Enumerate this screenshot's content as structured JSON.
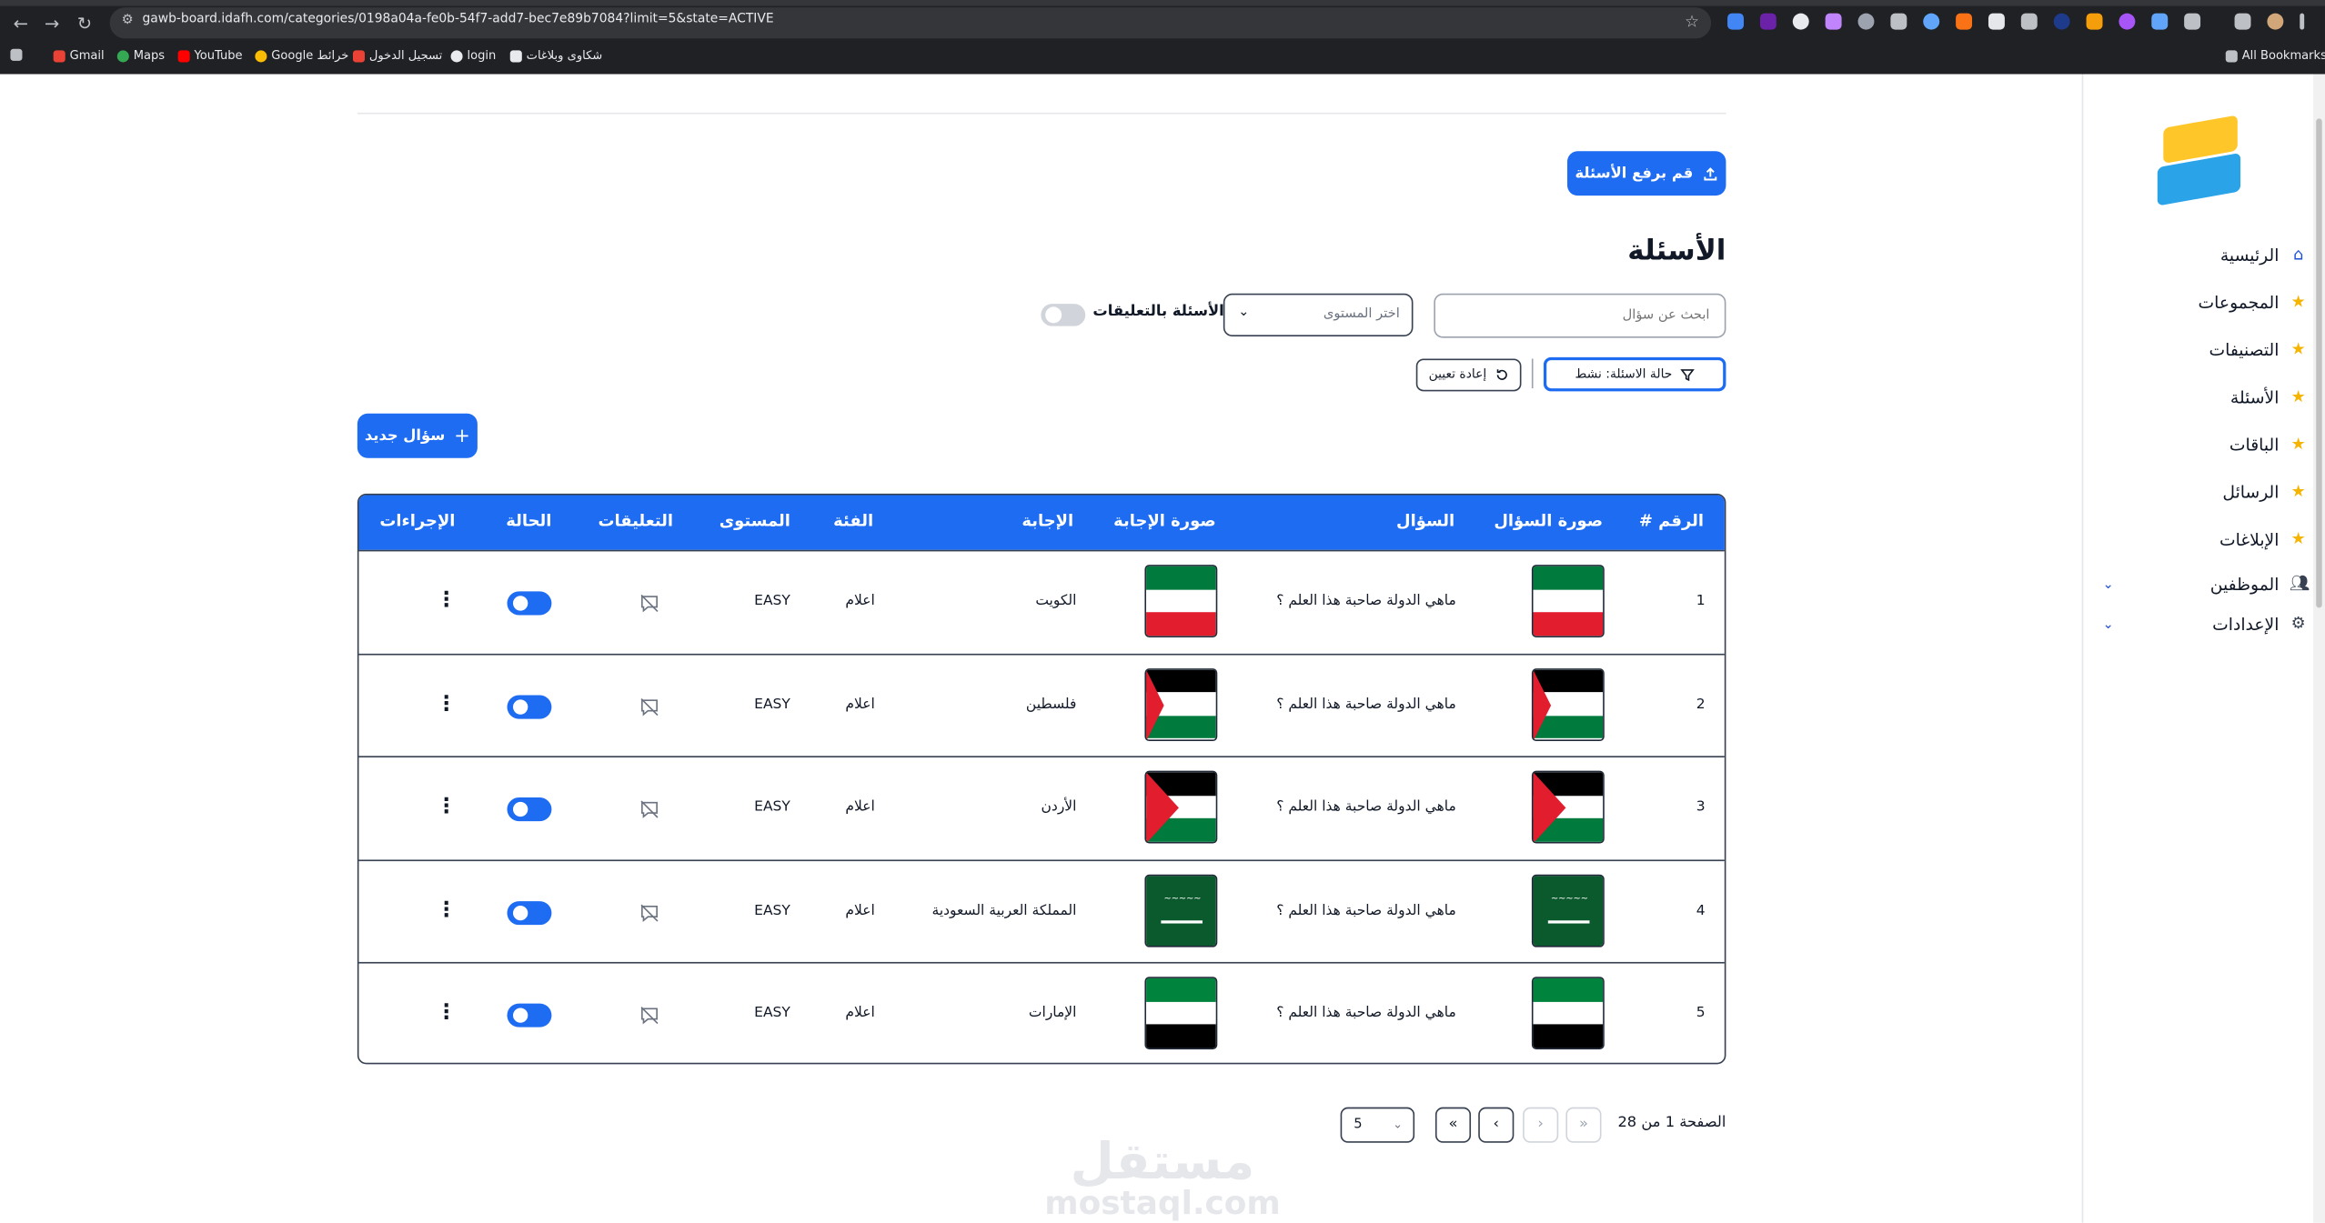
{
  "browser": {
    "url": "gawb-board.idafh.com/categories/0198a04a-fe0b-54f7-add7-bec7e89b7084?limit=5&state=ACTIVE",
    "bookmarks": [
      "Gmail",
      "Maps",
      "YouTube",
      "Google خرائط",
      "تسجيل الدخول",
      "login",
      "شكاوى وبلاغات"
    ],
    "all_bookmarks": "All Bookmarks"
  },
  "sidebar": {
    "items": [
      {
        "label": "الرئيسية",
        "icon": "home-icon"
      },
      {
        "label": "المجموعات",
        "icon": "star-icon"
      },
      {
        "label": "التصنيفات",
        "icon": "star-icon"
      },
      {
        "label": "الأسئلة",
        "icon": "star-icon"
      },
      {
        "label": "الباقات",
        "icon": "star-icon"
      },
      {
        "label": "الرسائل",
        "icon": "star-icon"
      },
      {
        "label": "الإبلاغات",
        "icon": "star-icon"
      },
      {
        "label": "الموظفين",
        "icon": "users-icon"
      },
      {
        "label": "الإعدادات",
        "icon": "gear-icon"
      }
    ]
  },
  "main": {
    "upload_button": "قم برفع الأسئلة",
    "title": "الأسئلة",
    "search_placeholder": "ابحث عن سؤال",
    "level_placeholder": "اختر المستوى",
    "comments_toggle_label": "الأسئلة بالتعليقات",
    "comments_toggle_on": false,
    "filter_chip": "حالة الاسئلة: نشط",
    "reset_button": "إعادة تعيين",
    "new_question_button": "سؤال جديد"
  },
  "table": {
    "headers": [
      "# الرقم",
      "صورة السؤال",
      "السؤال",
      "صورة الإجابة",
      "الإجابة",
      "الفئة",
      "المستوى",
      "التعليقات",
      "الحالة",
      "الإجراءات"
    ],
    "rows": [
      {
        "num": "1",
        "flag": "kuwait",
        "question": "ماهي الدولة صاحبة هذا العلم ؟",
        "answer": "الكويت",
        "category": "اعلام",
        "level": "EASY",
        "active": true
      },
      {
        "num": "2",
        "flag": "palestine",
        "question": "ماهي الدولة صاحبة هذا العلم ؟",
        "answer": "فلسطين",
        "category": "اعلام",
        "level": "EASY",
        "active": true
      },
      {
        "num": "3",
        "flag": "jordan",
        "question": "ماهي الدولة صاحبة هذا العلم ؟",
        "answer": "الأردن",
        "category": "اعلام",
        "level": "EASY",
        "active": true
      },
      {
        "num": "4",
        "flag": "saudi",
        "question": "ماهي الدولة صاحبة هذا العلم ؟",
        "answer": "المملكة العربية السعودية",
        "category": "اعلام",
        "level": "EASY",
        "active": true
      },
      {
        "num": "5",
        "flag": "uae",
        "question": "ماهي الدولة صاحبة هذا العلم ؟",
        "answer": "الإمارات",
        "category": "اعلام",
        "level": "EASY",
        "active": true
      }
    ]
  },
  "pagination": {
    "page_text": "الصفحة 1 من 28",
    "page_size": "5"
  },
  "watermark": {
    "ar": "مستقل",
    "en": "mostaql.com"
  },
  "colors": {
    "primary": "#1d6cf2",
    "star": "#f5b400"
  }
}
